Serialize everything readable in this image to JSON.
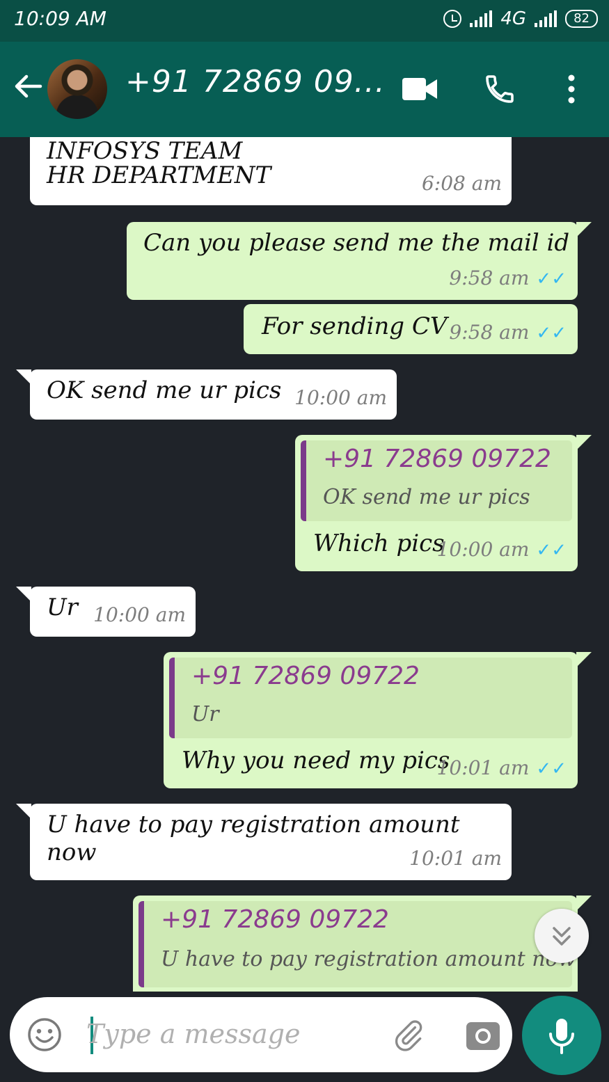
{
  "status_bar": {
    "time": "10:09 AM",
    "network": "4G",
    "battery": "82"
  },
  "header": {
    "contact_name": "+91 72869 09...",
    "icons": [
      "back-arrow-icon",
      "avatar",
      "video-call-icon",
      "phone-icon",
      "more-vert-icon"
    ]
  },
  "messages": [
    {
      "direction": "in",
      "lines": [
        "INFOSYS TEAM",
        "HR DEPARTMENT"
      ],
      "time": "6:08 am"
    },
    {
      "direction": "out",
      "text": "Can you please send me the mail id",
      "time": "9:58 am",
      "ticks": "✓✓"
    },
    {
      "direction": "out",
      "text": "For sending CV",
      "time": "9:58 am",
      "ticks": "✓✓"
    },
    {
      "direction": "in",
      "text": "OK send me ur pics",
      "time": "10:00 am"
    },
    {
      "direction": "out",
      "quote_author": "+91 72869 09722",
      "quote_text": "OK send me ur pics",
      "text": "Which pics",
      "time": "10:00 am",
      "ticks": "✓✓"
    },
    {
      "direction": "in",
      "text": "Ur",
      "time": "10:00 am"
    },
    {
      "direction": "out",
      "quote_author": "+91 72869 09722",
      "quote_text": "Ur",
      "text": "Why you need my pics",
      "time": "10:01 am",
      "ticks": "✓✓"
    },
    {
      "direction": "in",
      "lines": [
        "U have to pay registration amount",
        "now"
      ],
      "time": "10:01 am"
    },
    {
      "direction": "out",
      "quote_author": "+91 72869 09722",
      "quote_text": "U have to pay registration amount now"
    }
  ],
  "composer": {
    "placeholder": "Type a message"
  },
  "colors": {
    "header": "#075e54",
    "status_bar": "#0a4f45",
    "chat_background": "#1f2329",
    "outgoing_bubble": "#dcf8c6",
    "incoming_bubble": "#ffffff",
    "quote_author": "#8a3b8e",
    "read_ticks": "#34b7f1",
    "mic_button": "#128c7e"
  }
}
